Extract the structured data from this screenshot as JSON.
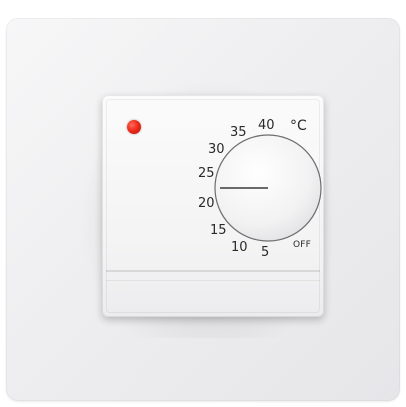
{
  "thermostat": {
    "unit": "°C",
    "scale": [
      {
        "key": "t5",
        "label": "5"
      },
      {
        "key": "t10",
        "label": "10"
      },
      {
        "key": "t15",
        "label": "15"
      },
      {
        "key": "t20",
        "label": "20"
      },
      {
        "key": "t25",
        "label": "25"
      },
      {
        "key": "t30",
        "label": "30"
      },
      {
        "key": "t35",
        "label": "35"
      },
      {
        "key": "t40",
        "label": "40"
      },
      {
        "key": "off",
        "label": "OFF"
      }
    ],
    "indicator_color": "#ef2b1b",
    "selected_setting": "22"
  }
}
